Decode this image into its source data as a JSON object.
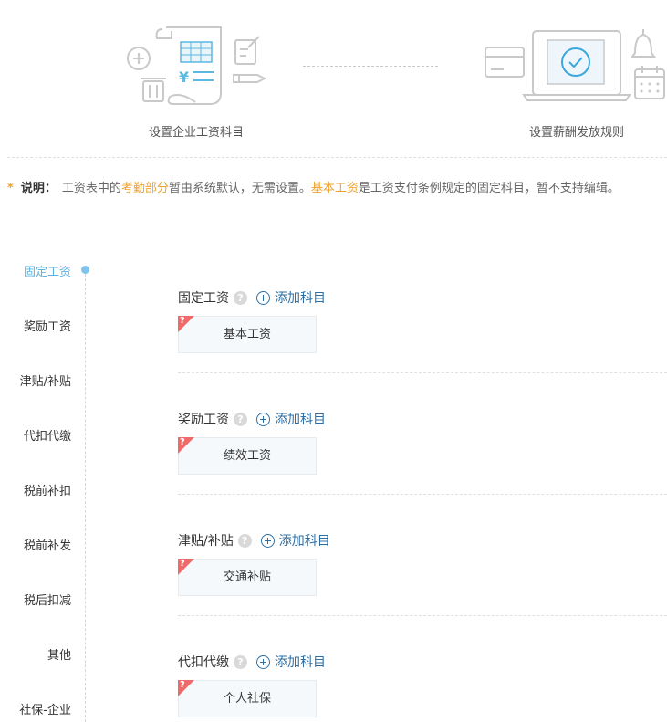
{
  "steps": [
    {
      "label": "设置企业工资科目"
    },
    {
      "label": "设置薪酬发放规则"
    }
  ],
  "note": {
    "star": "*",
    "title": "说明：",
    "text1": "工资表中的",
    "hl1": "考勤部分",
    "text2": "暂由系统默认，无需设置。",
    "hl2": "基本工资",
    "text3": "是工资支付条例规定的固定科目，暂不支持编辑。"
  },
  "nav": {
    "items": [
      {
        "label": "固定工资",
        "active": true
      },
      {
        "label": "奖励工资"
      },
      {
        "label": "津贴/补贴"
      },
      {
        "label": "代扣代缴"
      },
      {
        "label": "税前补扣"
      },
      {
        "label": "税前补发"
      },
      {
        "label": "税后扣减"
      },
      {
        "label": "其他"
      },
      {
        "label": "社保-企业"
      }
    ]
  },
  "sections": [
    {
      "title": "固定工资",
      "help": "?",
      "add_label": "添加科目",
      "items": [
        {
          "label": "基本工资",
          "corner": "?"
        }
      ]
    },
    {
      "title": "奖励工资",
      "help": "?",
      "add_label": "添加科目",
      "items": [
        {
          "label": "绩效工资",
          "corner": "?"
        }
      ]
    },
    {
      "title": "津贴/补贴",
      "help": "?",
      "add_label": "添加科目",
      "items": [
        {
          "label": "交通补贴",
          "corner": "?"
        }
      ]
    },
    {
      "title": "代扣代缴",
      "help": "?",
      "add_label": "添加科目",
      "items": [
        {
          "label": "个人社保",
          "corner": "?"
        }
      ]
    }
  ],
  "colors": {
    "accent_blue": "#2d6fa5",
    "active_nav": "#5bb3e3",
    "highlight_orange": "#f0a12b",
    "corner_red": "#f06a6a"
  }
}
